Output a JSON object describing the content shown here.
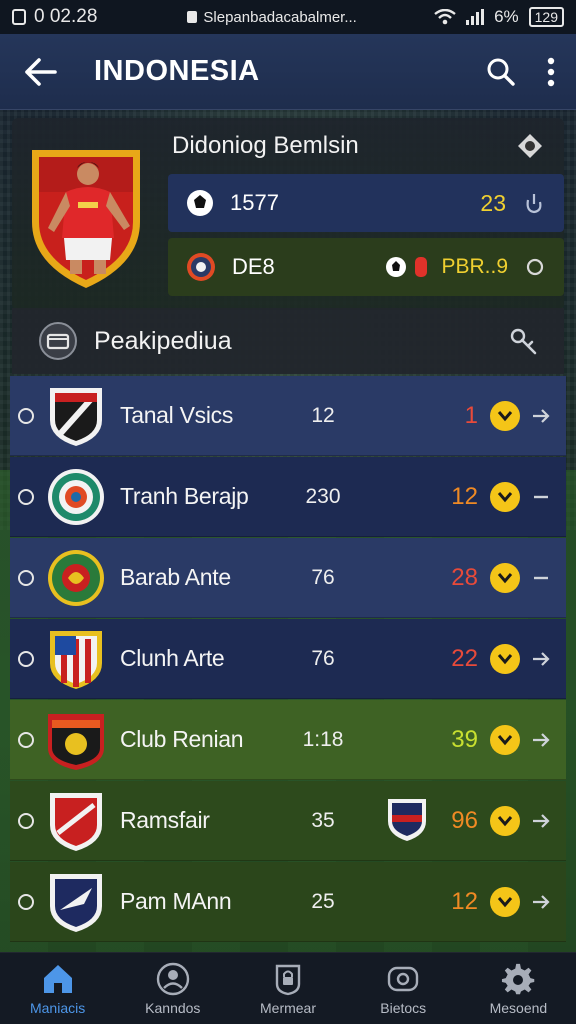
{
  "status_bar": {
    "time": "0 02.28",
    "url": "Slepanbadacabalmer...",
    "battery": "6%",
    "battery_box": "129"
  },
  "app_bar": {
    "title": "INDONESIA"
  },
  "profile": {
    "name": "Didoniog Bemlsin",
    "stat1": {
      "value": "1577",
      "score": "23"
    },
    "stat2": {
      "value": "DE8",
      "code": "PBR..9"
    }
  },
  "section": {
    "title": "Peakipediua"
  },
  "rows": [
    {
      "name": "Tanal Vsics",
      "mid": "12",
      "score": "1",
      "score_color": "#e84a3a",
      "bg": "#2a3a66"
    },
    {
      "name": "Tranh Berajp",
      "mid": "230",
      "score": "12",
      "score_color": "#f08a24",
      "bg": "#1d2a52"
    },
    {
      "name": "Barab Ante",
      "mid": "76",
      "score": "28",
      "score_color": "#e84a3a",
      "bg": "#2a3a66"
    },
    {
      "name": "Clunh Arte",
      "mid": "76",
      "score": "22",
      "score_color": "#e84a3a",
      "bg": "#1d2a52"
    },
    {
      "name": "Club Renian",
      "mid": "1:18",
      "score": "39",
      "score_color": "#c8e030",
      "bg": "#3e6224"
    },
    {
      "name": "Ramsfair",
      "mid": "35",
      "score": "96",
      "score_color": "#f08a24",
      "bg": "#2d4a1c"
    },
    {
      "name": "Pam MAnn",
      "mid": "25",
      "score": "12",
      "score_color": "#f08a24",
      "bg": "#2b461b"
    }
  ],
  "bottom_nav": [
    {
      "label": "Maniacis",
      "icon": "home-icon"
    },
    {
      "label": "Kanndos",
      "icon": "profile-icon"
    },
    {
      "label": "Mermear",
      "icon": "lock-icon"
    },
    {
      "label": "Bietocs",
      "icon": "eye-icon"
    },
    {
      "label": "Mesoend",
      "icon": "gear-icon"
    }
  ],
  "colors": {
    "accent": "#4d96e8",
    "chevron": "#f4c518",
    "appbar": "#25365a"
  }
}
